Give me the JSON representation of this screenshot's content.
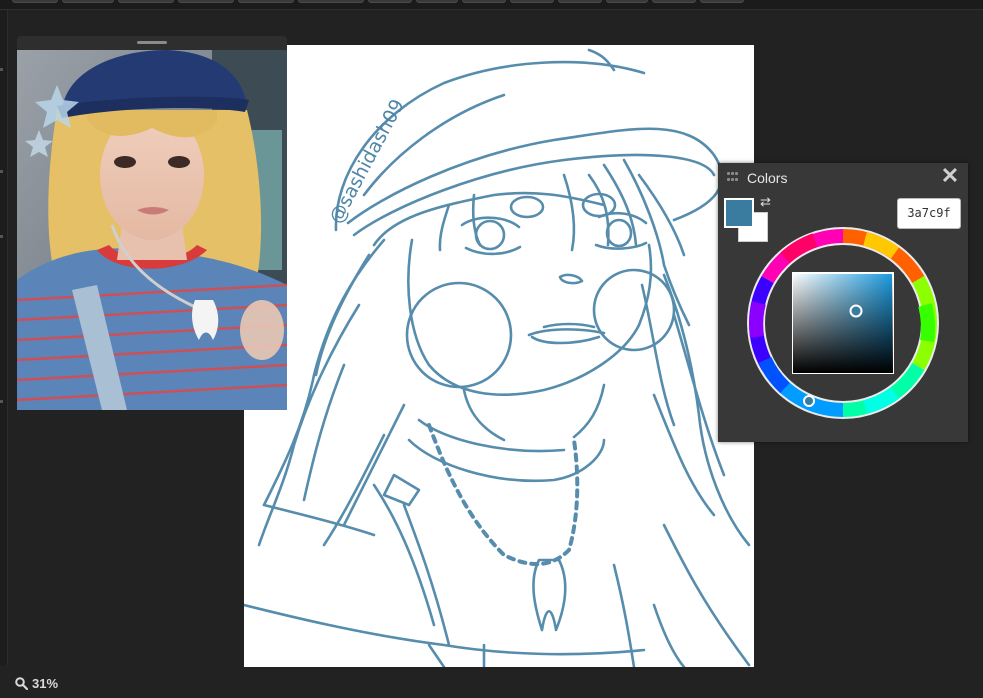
{
  "colors_panel": {
    "title": "Colors",
    "close_icon": "close-icon",
    "hex_value": "3a7c9f",
    "primary_color": "#3a7c9f",
    "secondary_color": "#ffffff",
    "swap_icon": "swap-icon"
  },
  "canvas": {
    "watermark": "@sashidash09",
    "stroke_color": "#4e86a8"
  },
  "status": {
    "zoom_icon": "zoom-icon",
    "zoom": "31%"
  }
}
